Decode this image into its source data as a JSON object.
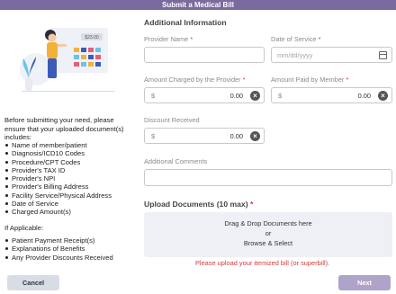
{
  "window": {
    "title": "Submit a Medical Bill"
  },
  "left": {
    "intro": "Before submitting your need, please ensure that your uploaded document(s) includes:",
    "required_items": [
      "Name of member/patient",
      "Diagnosis/ICD10 Codes",
      "Procedure/CPT Codes",
      "Provider's TAX ID",
      "Provider's NPI",
      "Provider's Billing Address",
      "Facility Service/Physical Address",
      "Date of Service",
      "Charged Amount(s)"
    ],
    "if_applicable_label": "If Applicable:",
    "applicable_items": [
      "Patient Payment Receipt(s)",
      "Explanations of Benefits",
      "Any Provider Discounts Received"
    ],
    "illustration": {
      "price_tag": "$23.00"
    }
  },
  "form": {
    "section_title": "Additional Information",
    "provider_name": {
      "label": "Provider Name",
      "required": "*",
      "value": "",
      "placeholder": ""
    },
    "date_of_service": {
      "label": "Date of Service",
      "required": "*",
      "placeholder": "mm/dd/yyyy",
      "icon": "calendar-icon"
    },
    "amount_charged": {
      "label": "Amount Charged by the Provider",
      "required": "*",
      "currency": "$",
      "value": "0.00",
      "icon": "clear-icon"
    },
    "amount_paid": {
      "label": "Amount Paid by Member",
      "required": "*",
      "currency": "$",
      "value": "0.00",
      "icon": "clear-icon"
    },
    "discount": {
      "label": "Discount Received",
      "currency": "$",
      "value": "0.00",
      "icon": "clear-icon"
    },
    "comments": {
      "label": "Additional Comments",
      "value": ""
    }
  },
  "upload": {
    "title": "Upload Documents (10 max)",
    "required": "*",
    "drop_text": "Drag & Drop Documents here",
    "or_text": "or",
    "browse_text": "Browse & Select",
    "warning": "Please upload your itemized bill (or superbill)."
  },
  "footer": {
    "cancel_label": "Cancel",
    "next_label": "Next"
  },
  "colors": {
    "title_bar": "#7a6a9e",
    "next_button": "#b0a3c9",
    "required": "#d43b3b",
    "dropzone": "#eef0f5"
  }
}
